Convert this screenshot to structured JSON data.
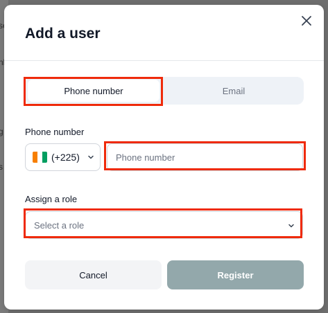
{
  "background": {
    "fragments": [
      "se",
      "nl",
      "g",
      "s"
    ]
  },
  "modal": {
    "title": "Add a user",
    "close_icon": "close-icon",
    "tabs": [
      {
        "label": "Phone number",
        "active": true
      },
      {
        "label": "Email",
        "active": false
      }
    ],
    "phone": {
      "label": "Phone number",
      "country_code": "(+225)",
      "flag_colors": [
        "#f77f00",
        "#ffffff",
        "#009e60"
      ],
      "placeholder": "Phone number"
    },
    "role": {
      "label": "Assign a role",
      "placeholder": "Select a role"
    },
    "buttons": {
      "cancel": "Cancel",
      "register": "Register"
    }
  },
  "colors": {
    "highlight": "#ef2a0a",
    "register_bg": "#93a8ab"
  }
}
